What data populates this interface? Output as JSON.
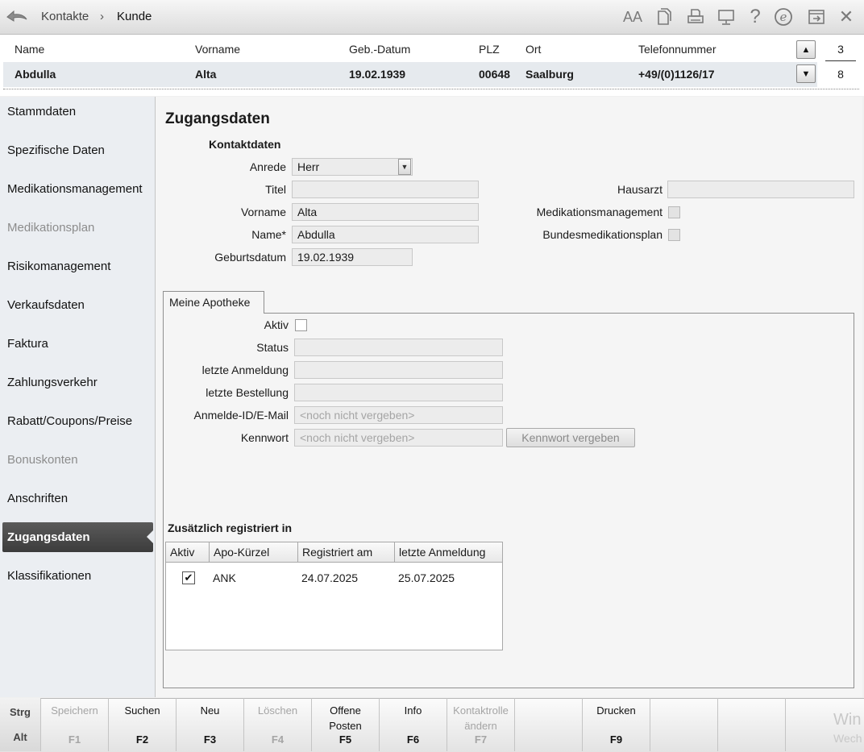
{
  "breadcrumb": {
    "first": "Kontakte",
    "separator": "›",
    "second": "Kunde"
  },
  "toolbar": {
    "icons": [
      "font-size-icon",
      "document-icon",
      "printer-icon",
      "monitor-icon",
      "help-icon",
      "e-icon",
      "window-icon",
      "close-icon"
    ],
    "help_glyph": "?",
    "e_glyph": "e",
    "close_glyph": "✕",
    "font_glyph": "AA"
  },
  "customer": {
    "headers": {
      "name": "Name",
      "vorname": "Vorname",
      "geb": "Geb.-Datum",
      "plz": "PLZ",
      "ort": "Ort",
      "tel": "Telefonnummer"
    },
    "values": {
      "name": "Abdulla",
      "vorname": "Alta",
      "geb": "19.02.1939",
      "plz": "00648",
      "ort": "Saalburg",
      "tel": "+49/(0)1126/17"
    },
    "pager": {
      "current": "3",
      "total": "8",
      "up": "▲",
      "down": "▼"
    }
  },
  "sidebar": {
    "items": [
      {
        "label": "Stammdaten",
        "disabled": false
      },
      {
        "label": "Spezifische Daten",
        "disabled": false
      },
      {
        "label": "Medikationsmanagement",
        "disabled": false
      },
      {
        "label": "Medikationsplan",
        "disabled": true
      },
      {
        "label": "Risikomanagement",
        "disabled": false
      },
      {
        "label": "Verkaufsdaten",
        "disabled": false
      },
      {
        "label": "Faktura",
        "disabled": false
      },
      {
        "label": "Zahlungsverkehr",
        "disabled": false
      },
      {
        "label": "Rabatt/Coupons/Preise",
        "disabled": false
      },
      {
        "label": "Bonuskonten",
        "disabled": true
      },
      {
        "label": "Anschriften",
        "disabled": false
      },
      {
        "label": "Zugangsdaten",
        "disabled": false,
        "active": true
      },
      {
        "label": "Klassifikationen",
        "disabled": false
      }
    ]
  },
  "page": {
    "title": "Zugangsdaten",
    "kontakt": {
      "title": "Kontaktdaten",
      "anrede_label": "Anrede",
      "anrede_value": "Herr",
      "titel_label": "Titel",
      "titel_value": "",
      "vorname_label": "Vorname",
      "vorname_value": "Alta",
      "name_label": "Name*",
      "name_value": "Abdulla",
      "geb_label": "Geburtsdatum",
      "geb_value": "19.02.1939",
      "hausarzt_label": "Hausarzt",
      "hausarzt_value": "",
      "medman_label": "Medikationsmanagement",
      "bmp_label": "Bundesmedikationsplan"
    },
    "apotheke": {
      "tab": "Meine Apotheke",
      "aktiv_label": "Aktiv",
      "status_label": "Status",
      "status_value": "",
      "anmeldung_label": "letzte Anmeldung",
      "anmeldung_value": "",
      "bestellung_label": "letzte Bestellung",
      "bestellung_value": "",
      "id_label": "Anmelde-ID/E-Mail",
      "id_placeholder": "<noch nicht vergeben>",
      "kennwort_label": "Kennwort",
      "kennwort_placeholder": "<noch nicht vergeben>",
      "kennwort_button": "Kennwort vergeben"
    },
    "registriert": {
      "title": "Zusätzlich registriert in",
      "columns": [
        "Aktiv",
        "Apo-Kürzel",
        "Registriert am",
        "letzte Anmeldung"
      ],
      "rows": [
        {
          "aktiv": true,
          "check": "✔",
          "kuerzel": "ANK",
          "registriert": "24.07.2025",
          "anmeldung": "25.07.2025"
        }
      ]
    }
  },
  "fkeys": {
    "strg": "Strg",
    "alt": "Alt",
    "keys": [
      {
        "label": "Speichern",
        "key": "F1",
        "disabled": true
      },
      {
        "label": "Suchen",
        "key": "F2",
        "disabled": false
      },
      {
        "label": "Neu",
        "key": "F3",
        "disabled": false
      },
      {
        "label": "Löschen",
        "key": "F4",
        "disabled": true
      },
      {
        "label": "Offene Posten",
        "key": "F5",
        "disabled": false
      },
      {
        "label": "Info",
        "key": "F6",
        "disabled": false
      },
      {
        "label": "Kontaktrolle ändern",
        "key": "F7",
        "disabled": true
      },
      {
        "label": "",
        "key": "",
        "disabled": false
      },
      {
        "label": "Drucken",
        "key": "F9",
        "disabled": false
      },
      {
        "label": "",
        "key": "",
        "disabled": false
      },
      {
        "label": "",
        "key": "",
        "disabled": false
      },
      {
        "label": "",
        "key": "",
        "disabled": false
      }
    ]
  },
  "watermark": {
    "line1": "Win",
    "line2": "Wech"
  }
}
